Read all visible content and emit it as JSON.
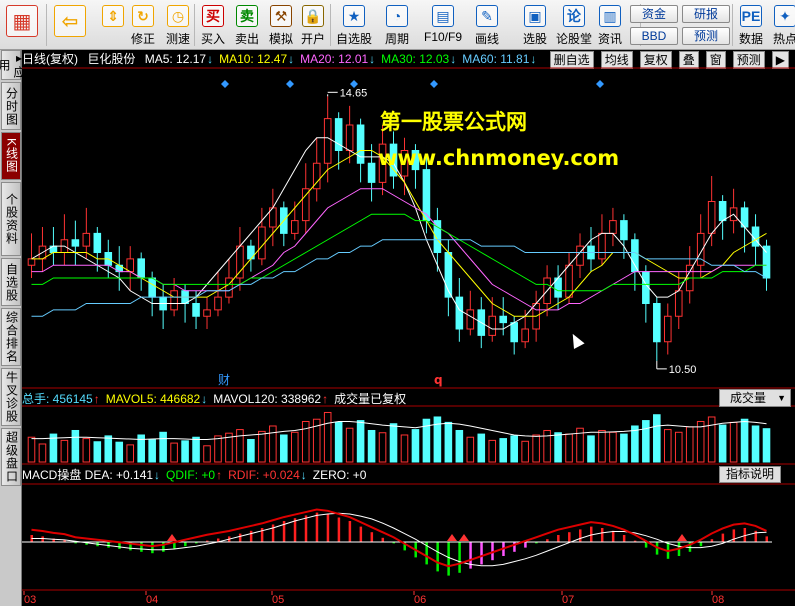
{
  "toolbar": {
    "buttons": [
      {
        "label": "",
        "icon": "windows-grid-icon",
        "color": "#d63a2a"
      },
      {
        "label": "",
        "icon": "back-arrow-icon",
        "color": "#f0a500"
      },
      {
        "label": "",
        "icon": "up-down-arrows-icon",
        "color": "#f0a500"
      },
      {
        "label": "修正",
        "icon": "refresh-icon",
        "color": "#f0a500"
      },
      {
        "label": "测速",
        "icon": "clock-icon",
        "color": "#f0a500"
      },
      {
        "label": "买入",
        "icon": "buy-icon",
        "color": "#cc0000"
      },
      {
        "label": "卖出",
        "icon": "sell-icon",
        "color": "#008800"
      },
      {
        "label": "模拟",
        "icon": "hammer-icon",
        "color": "#884400"
      },
      {
        "label": "开户",
        "icon": "lock-icon",
        "color": "#886600"
      },
      {
        "label": "自选股",
        "icon": "star-icon",
        "color": "#1060c0"
      },
      {
        "label": "周期",
        "icon": "period-icon",
        "color": "#1060c0"
      },
      {
        "label": "F10/F9",
        "icon": "f10-icon",
        "color": "#1060c0"
      },
      {
        "label": "画线",
        "icon": "pencil-icon",
        "color": "#1060c0"
      },
      {
        "label": "选股",
        "icon": "monitor-icon",
        "color": "#1060c0"
      },
      {
        "label": "论股堂",
        "icon": "lun-icon",
        "color": "#1060c0"
      },
      {
        "label": "资讯",
        "icon": "document-icon",
        "color": "#1060c0"
      },
      {
        "label": "数据",
        "icon": "pe-icon",
        "color": "#1060c0"
      },
      {
        "label": "热点",
        "icon": "hotspot-icon",
        "color": "#1060c0"
      }
    ],
    "small_buttons": [
      "资金",
      "BBD",
      "研报",
      "预测"
    ]
  },
  "left_tabs": [
    {
      "label": "应用",
      "active": false
    },
    {
      "label": "分时图",
      "active": false
    },
    {
      "label": "K线图",
      "active": true
    },
    {
      "label": "个股资料",
      "active": false
    },
    {
      "label": "自选股",
      "active": false
    },
    {
      "label": "综合排名",
      "active": false
    },
    {
      "label": "牛叉诊股",
      "active": false
    },
    {
      "label": "超级盘口",
      "active": false
    }
  ],
  "header": {
    "period": "日线(复权)",
    "stock": "巨化股份",
    "ma": [
      {
        "label": "MA5: 12.17",
        "arrow": "↓",
        "color": "#ffffff"
      },
      {
        "label": "MA10: 12.47",
        "arrow": "↓",
        "color": "#ffff00"
      },
      {
        "label": "MA20: 12.01",
        "arrow": "↓",
        "color": "#ff66ff"
      },
      {
        "label": "MA30: 12.03",
        "arrow": "↓",
        "color": "#00ff00"
      },
      {
        "label": "MA60: 11.81",
        "arrow": "↓",
        "color": "#66ccff"
      }
    ],
    "right_buttons": [
      "删自选",
      "均线",
      "复权",
      "叠",
      "窗",
      "预测"
    ]
  },
  "watermark": {
    "line1": "第一股票公式网",
    "line2": "www.chnmoney.com"
  },
  "price_labels": {
    "high": "14.65",
    "low": "10.50"
  },
  "markers": {
    "cai": "财",
    "q": "q"
  },
  "volume_header": {
    "items": [
      {
        "label": "总手: 456145",
        "arrow": "↑",
        "color": "#55ddff"
      },
      {
        "label": "MAVOL5: 446682",
        "arrow": "↓",
        "color": "#ffff00"
      },
      {
        "label": "MAVOL120: 338962",
        "arrow": "↑",
        "color": "#ffffff"
      },
      {
        "label": "成交量已复权",
        "arrow": "",
        "color": "#ffffff"
      }
    ],
    "dropdown": "成交量"
  },
  "macd_header": {
    "items": [
      {
        "label": "MACD操盘 DEA: +0.141",
        "arrow": "↓",
        "color": "#ffffff"
      },
      {
        "label": "QDIF: +0",
        "arrow": "↑",
        "color": "#00ff00"
      },
      {
        "label": "RDIF: +0.024",
        "arrow": "↓",
        "color": "#ff3333"
      },
      {
        "label": "ZERO: +0",
        "arrow": "",
        "color": "#ffffff"
      }
    ],
    "button": "指标说明"
  },
  "x_labels": [
    "03",
    "04",
    "05",
    "06",
    "07",
    "08"
  ],
  "chart_data": {
    "type": "candlestick",
    "y_range": [
      10.2,
      15.0
    ],
    "candles": [
      [
        12.0,
        12.1,
        12.5,
        11.8
      ],
      [
        12.1,
        12.3,
        12.6,
        11.9
      ],
      [
        12.3,
        12.2,
        12.6,
        12.0
      ],
      [
        12.2,
        12.4,
        12.8,
        12.0
      ],
      [
        12.4,
        12.3,
        12.7,
        12.0
      ],
      [
        12.3,
        12.5,
        12.9,
        12.1
      ],
      [
        12.5,
        12.2,
        12.6,
        11.9
      ],
      [
        12.2,
        12.0,
        12.4,
        11.8
      ],
      [
        12.0,
        11.9,
        12.3,
        11.6
      ],
      [
        11.9,
        12.1,
        12.3,
        11.6
      ],
      [
        12.1,
        11.8,
        12.2,
        11.6
      ],
      [
        11.8,
        11.5,
        11.9,
        11.2
      ],
      [
        11.5,
        11.3,
        11.7,
        11.0
      ],
      [
        11.3,
        11.6,
        11.8,
        11.2
      ],
      [
        11.6,
        11.4,
        11.7,
        11.1
      ],
      [
        11.4,
        11.2,
        11.6,
        11.0
      ],
      [
        11.2,
        11.3,
        11.5,
        11.0
      ],
      [
        11.3,
        11.5,
        11.9,
        11.2
      ],
      [
        11.5,
        11.8,
        12.1,
        11.4
      ],
      [
        11.8,
        12.3,
        12.6,
        11.6
      ],
      [
        12.3,
        12.1,
        12.4,
        11.9
      ],
      [
        12.1,
        12.6,
        12.9,
        12.0
      ],
      [
        12.6,
        12.9,
        13.2,
        12.3
      ],
      [
        12.9,
        12.5,
        13.0,
        12.3
      ],
      [
        12.5,
        12.7,
        13.0,
        12.4
      ],
      [
        12.7,
        13.2,
        13.6,
        12.5
      ],
      [
        13.2,
        13.6,
        14.0,
        13.0
      ],
      [
        13.6,
        14.3,
        14.65,
        13.3
      ],
      [
        14.3,
        13.8,
        14.4,
        13.5
      ],
      [
        13.8,
        14.2,
        14.5,
        13.6
      ],
      [
        14.2,
        13.6,
        14.3,
        13.3
      ],
      [
        13.6,
        13.3,
        13.9,
        13.0
      ],
      [
        13.3,
        13.9,
        14.2,
        13.1
      ],
      [
        13.9,
        13.4,
        14.1,
        13.2
      ],
      [
        13.4,
        13.8,
        14.0,
        13.1
      ],
      [
        13.8,
        13.5,
        13.9,
        13.2
      ],
      [
        13.5,
        12.7,
        13.7,
        12.5
      ],
      [
        12.7,
        12.2,
        12.9,
        11.9
      ],
      [
        12.2,
        11.5,
        12.4,
        11.2
      ],
      [
        11.5,
        11.0,
        11.8,
        10.8
      ],
      [
        11.0,
        11.3,
        11.6,
        10.9
      ],
      [
        11.3,
        10.9,
        11.5,
        10.7
      ],
      [
        10.9,
        11.2,
        11.5,
        10.8
      ],
      [
        11.2,
        11.1,
        11.5,
        10.9
      ],
      [
        11.1,
        10.8,
        11.2,
        10.6
      ],
      [
        10.8,
        11.0,
        11.3,
        10.7
      ],
      [
        11.0,
        11.4,
        11.6,
        10.8
      ],
      [
        11.4,
        11.8,
        12.0,
        11.2
      ],
      [
        11.8,
        11.5,
        12.0,
        11.3
      ],
      [
        11.5,
        12.0,
        12.2,
        11.4
      ],
      [
        12.0,
        12.3,
        12.5,
        11.8
      ],
      [
        12.3,
        12.1,
        12.6,
        11.9
      ],
      [
        12.1,
        12.5,
        12.8,
        12.0
      ],
      [
        12.5,
        12.7,
        12.9,
        12.3
      ],
      [
        12.7,
        12.4,
        12.8,
        12.1
      ],
      [
        12.4,
        11.9,
        12.5,
        11.6
      ],
      [
        11.9,
        11.4,
        12.0,
        11.1
      ],
      [
        11.4,
        10.8,
        11.5,
        10.5
      ],
      [
        10.8,
        11.2,
        11.4,
        10.6
      ],
      [
        11.2,
        11.6,
        11.9,
        11.0
      ],
      [
        11.6,
        12.0,
        12.3,
        11.4
      ],
      [
        12.0,
        12.5,
        12.8,
        11.8
      ],
      [
        12.5,
        13.0,
        13.4,
        12.3
      ],
      [
        13.0,
        12.7,
        13.1,
        12.4
      ],
      [
        12.7,
        12.9,
        13.2,
        12.5
      ],
      [
        12.9,
        12.6,
        13.0,
        12.2
      ],
      [
        12.6,
        12.3,
        12.8,
        12.0
      ],
      [
        12.3,
        11.8,
        12.4,
        11.6
      ]
    ],
    "ma": {
      "MA5": [
        12.1,
        12.2,
        12.3,
        12.3,
        12.2,
        12.1,
        12.0,
        11.9,
        11.8,
        11.6,
        11.5,
        11.4,
        11.4,
        11.4,
        11.4,
        11.5,
        11.7,
        11.9,
        12.1,
        12.3,
        12.5,
        12.7,
        12.9,
        13.2,
        13.5,
        13.8,
        14.0,
        14.0,
        13.9,
        13.8,
        13.7,
        13.7,
        13.7,
        13.6,
        13.3,
        12.9,
        12.4,
        12.0,
        11.6,
        11.3,
        11.2,
        11.1,
        11.0,
        11.0,
        11.1,
        11.2,
        11.4,
        11.6,
        11.8,
        12.0,
        12.2,
        12.4,
        12.5,
        12.5,
        12.3,
        12.0,
        11.7,
        11.5,
        11.5,
        11.6,
        11.9,
        12.2,
        12.5,
        12.7,
        12.8,
        12.6,
        12.4,
        12.2
      ],
      "MA10": [
        12.1,
        12.1,
        12.2,
        12.2,
        12.2,
        12.2,
        12.1,
        12.1,
        12.0,
        11.9,
        11.8,
        11.7,
        11.6,
        11.5,
        11.5,
        11.5,
        11.5,
        11.6,
        11.7,
        11.9,
        12.1,
        12.3,
        12.5,
        12.7,
        12.9,
        13.1,
        13.3,
        13.5,
        13.6,
        13.7,
        13.8,
        13.8,
        13.7,
        13.5,
        13.3,
        13.0,
        12.7,
        12.4,
        12.2,
        12.0,
        11.8,
        11.6,
        11.4,
        11.3,
        11.2,
        11.2,
        11.2,
        11.3,
        11.4,
        11.5,
        11.7,
        11.9,
        12.0,
        12.2,
        12.2,
        12.2,
        12.1,
        12.0,
        11.9,
        11.8,
        11.8,
        11.8,
        11.9,
        12.0,
        12.2,
        12.3,
        12.4,
        12.5
      ],
      "MA20": [
        11.9,
        11.9,
        12.0,
        12.0,
        12.0,
        12.0,
        12.0,
        12.0,
        11.9,
        11.9,
        11.8,
        11.8,
        11.7,
        11.7,
        11.6,
        11.6,
        11.6,
        11.6,
        11.6,
        11.7,
        11.8,
        11.9,
        12.0,
        12.2,
        12.3,
        12.5,
        12.7,
        12.9,
        13.0,
        13.1,
        13.2,
        13.2,
        13.2,
        13.1,
        13.0,
        12.9,
        12.8,
        12.6,
        12.5,
        12.3,
        12.1,
        11.9,
        11.7,
        11.6,
        11.5,
        11.4,
        11.3,
        11.3,
        11.3,
        11.4,
        11.4,
        11.5,
        11.6,
        11.7,
        11.8,
        11.9,
        11.9,
        11.9,
        11.9,
        11.9,
        11.9,
        11.9,
        11.9,
        12.0,
        12.0,
        12.0,
        12.0,
        12.0
      ],
      "MA30": [
        11.7,
        11.7,
        11.8,
        11.8,
        11.8,
        11.8,
        11.8,
        11.8,
        11.8,
        11.8,
        11.8,
        11.8,
        11.7,
        11.7,
        11.7,
        11.7,
        11.7,
        11.7,
        11.7,
        11.7,
        11.8,
        11.8,
        11.9,
        12.0,
        12.1,
        12.2,
        12.3,
        12.4,
        12.5,
        12.6,
        12.7,
        12.8,
        12.8,
        12.8,
        12.8,
        12.7,
        12.7,
        12.6,
        12.5,
        12.4,
        12.3,
        12.2,
        12.1,
        12.0,
        11.9,
        11.8,
        11.7,
        11.7,
        11.6,
        11.6,
        11.6,
        11.6,
        11.6,
        11.7,
        11.7,
        11.7,
        11.7,
        11.7,
        11.7,
        11.7,
        11.8,
        11.8,
        11.8,
        11.9,
        11.9,
        11.9,
        12.0,
        12.0
      ],
      "MA60": [
        11.2,
        11.2,
        11.3,
        11.3,
        11.3,
        11.4,
        11.4,
        11.4,
        11.4,
        11.4,
        11.5,
        11.5,
        11.5,
        11.5,
        11.5,
        11.5,
        11.6,
        11.6,
        11.6,
        11.7,
        11.7,
        11.8,
        11.8,
        11.9,
        11.9,
        12.0,
        12.1,
        12.1,
        12.2,
        12.2,
        12.3,
        12.3,
        12.4,
        12.4,
        12.4,
        12.4,
        12.4,
        12.4,
        12.4,
        12.4,
        12.4,
        12.3,
        12.3,
        12.3,
        12.3,
        12.2,
        12.2,
        12.2,
        12.2,
        12.2,
        12.2,
        12.2,
        12.2,
        12.2,
        12.2,
        12.2,
        12.1,
        12.1,
        12.1,
        12.1,
        12.1,
        12.1,
        12.0,
        12.0,
        12.0,
        11.9,
        11.9,
        11.8
      ]
    },
    "volume": [
      55,
      40,
      62,
      48,
      70,
      52,
      45,
      58,
      44,
      38,
      60,
      50,
      66,
      42,
      47,
      55,
      36,
      58,
      64,
      72,
      50,
      68,
      80,
      60,
      66,
      90,
      95,
      110,
      88,
      75,
      92,
      70,
      65,
      85,
      60,
      72,
      95,
      100,
      88,
      70,
      55,
      62,
      48,
      52,
      58,
      46,
      60,
      70,
      65,
      62,
      75,
      58,
      70,
      66,
      62,
      80,
      92,
      105,
      72,
      66,
      78,
      90,
      100,
      82,
      88,
      95,
      80,
      74
    ],
    "volume_ma": [
      52,
      52,
      53,
      54,
      55,
      55,
      54,
      53,
      52,
      51,
      50,
      51,
      52,
      52,
      51,
      50,
      50,
      52,
      55,
      58,
      60,
      62,
      65,
      68,
      70,
      74,
      80,
      86,
      90,
      90,
      88,
      85,
      82,
      80,
      78,
      76,
      80,
      84,
      86,
      84,
      80,
      75,
      70,
      65,
      60,
      58,
      57,
      58,
      60,
      62,
      64,
      66,
      66,
      67,
      68,
      70,
      74,
      80,
      82,
      80,
      78,
      78,
      82,
      86,
      88,
      90,
      88,
      85
    ],
    "macd_bars": [
      0.1,
      0.08,
      0.05,
      0.03,
      -0.02,
      -0.04,
      -0.06,
      -0.08,
      -0.1,
      -0.12,
      -0.14,
      -0.16,
      -0.14,
      -0.1,
      -0.06,
      -0.02,
      0.02,
      0.05,
      0.08,
      0.12,
      0.16,
      0.2,
      0.25,
      0.3,
      0.34,
      0.38,
      0.42,
      0.4,
      0.35,
      0.3,
      0.22,
      0.14,
      0.06,
      -0.02,
      -0.12,
      -0.22,
      -0.32,
      -0.42,
      -0.48,
      -0.44,
      -0.38,
      -0.32,
      -0.26,
      -0.2,
      -0.14,
      -0.08,
      -0.02,
      0.04,
      0.1,
      0.14,
      0.18,
      0.22,
      0.2,
      0.16,
      0.1,
      0.02,
      -0.08,
      -0.18,
      -0.24,
      -0.2,
      -0.14,
      -0.06,
      0.04,
      0.12,
      0.18,
      0.2,
      0.16,
      0.08
    ],
    "macd_dea": [
      0.05,
      0.05,
      0.04,
      0.03,
      0.01,
      -0.01,
      -0.03,
      -0.05,
      -0.07,
      -0.09,
      -0.1,
      -0.11,
      -0.11,
      -0.1,
      -0.08,
      -0.06,
      -0.03,
      0.0,
      0.04,
      0.08,
      0.12,
      0.16,
      0.2,
      0.25,
      0.3,
      0.34,
      0.38,
      0.4,
      0.41,
      0.4,
      0.37,
      0.33,
      0.27,
      0.2,
      0.12,
      0.04,
      -0.05,
      -0.14,
      -0.22,
      -0.28,
      -0.32,
      -0.34,
      -0.34,
      -0.32,
      -0.28,
      -0.24,
      -0.19,
      -0.13,
      -0.07,
      -0.01,
      0.05,
      0.1,
      0.13,
      0.15,
      0.15,
      0.13,
      0.09,
      0.04,
      -0.02,
      -0.06,
      -0.08,
      -0.08,
      -0.06,
      -0.02,
      0.04,
      0.09,
      0.13,
      0.14
    ]
  }
}
